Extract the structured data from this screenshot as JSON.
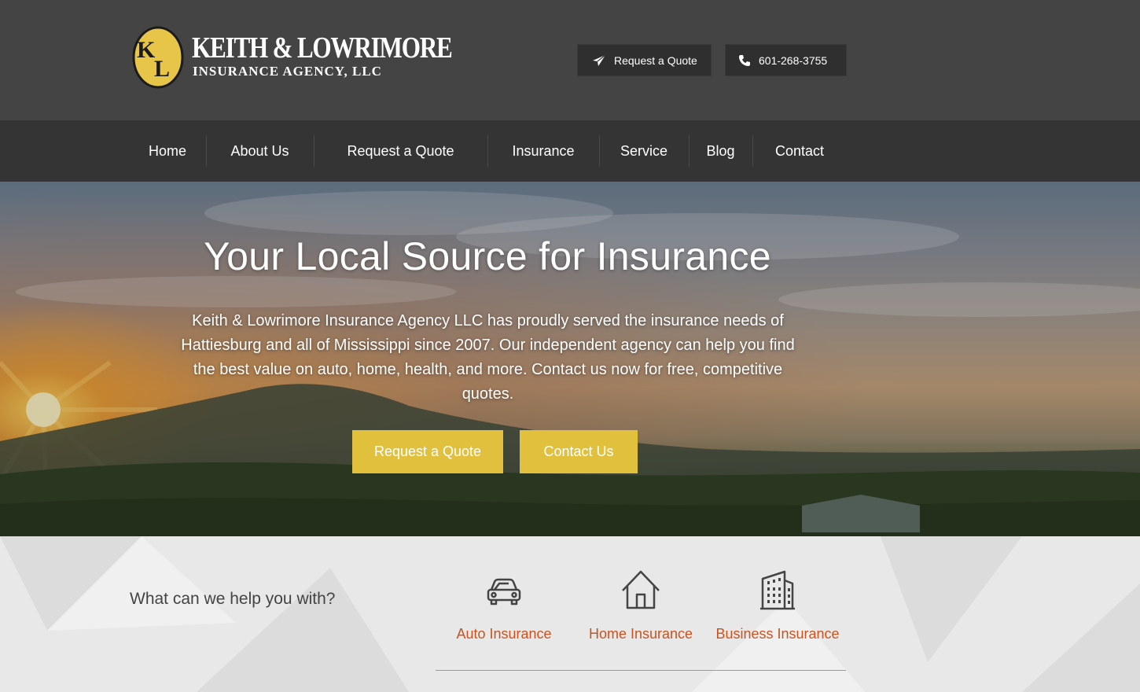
{
  "header": {
    "logo": {
      "monogram": "KL",
      "name": "KEITH & LOWRIMORE",
      "subtitle": "INSURANCE AGENCY, LLC"
    },
    "quote_button": {
      "label": "Request a Quote",
      "icon": "paper-plane-icon"
    },
    "phone_button": {
      "label": "601-268-3755",
      "icon": "phone-icon"
    }
  },
  "nav": {
    "items": [
      {
        "label": "Home"
      },
      {
        "label": "About Us"
      },
      {
        "label": "Request a Quote"
      },
      {
        "label": "Insurance"
      },
      {
        "label": "Service"
      },
      {
        "label": "Blog"
      },
      {
        "label": "Contact"
      }
    ]
  },
  "hero": {
    "title": "Your Local Source for Insurance",
    "text": "Keith & Lowrimore Insurance Agency LLC has proudly served the insurance needs of Hattiesburg and all of Mississippi since 2007. Our independent agency can help you find the best value on auto, home, health, and more. Contact us now for free, competitive quotes.",
    "primary_button": "Request a Quote",
    "secondary_button": "Contact Us"
  },
  "help": {
    "question": "What can we help you with?",
    "services": [
      {
        "label": "Auto Insurance",
        "icon": "car-icon"
      },
      {
        "label": "Home Insurance",
        "icon": "house-icon"
      },
      {
        "label": "Business Insurance",
        "icon": "building-icon"
      }
    ]
  },
  "colors": {
    "header_bg": "#444444",
    "nav_bg": "#343434",
    "button_dark": "#2f2f2f",
    "accent_yellow": "#e0c03c",
    "service_link": "#c8531e"
  }
}
